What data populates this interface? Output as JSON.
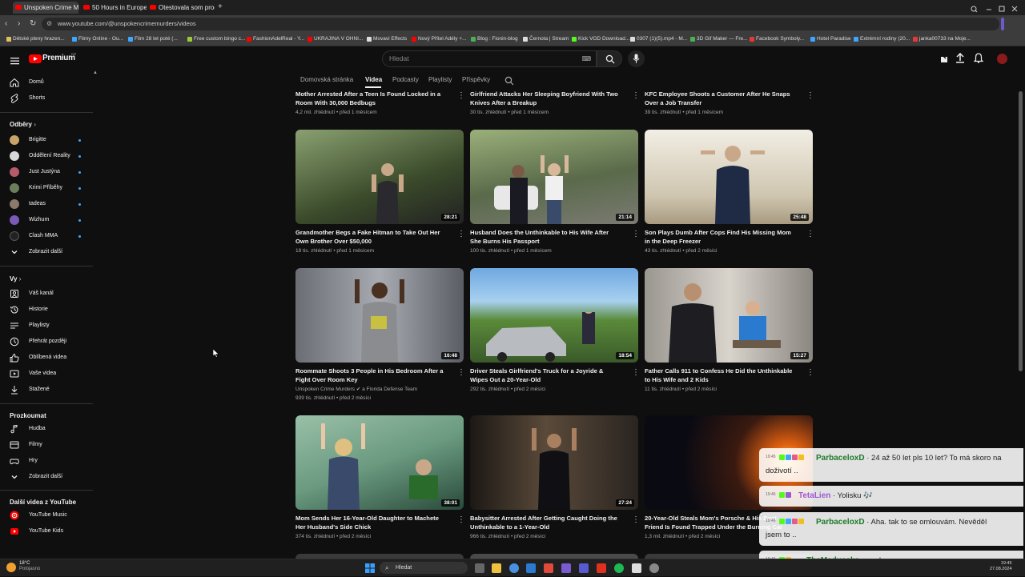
{
  "browser": {
    "tabs": [
      {
        "label": "Unspoken Crime Murders",
        "active": true
      },
      {
        "label": "50 Hours in Europe's Mo",
        "active": false
      },
      {
        "label": "Otestovala som produkty",
        "active": false
      }
    ],
    "url": "www.youtube.com/@unspokencrimemurders/videos",
    "bookmarks": [
      "Dětské pleny hrazen...",
      "Filmy Online - Ou...",
      "Film 28 let poté (...",
      "Free custom bingo c...",
      "FashionAdelReal - Y...",
      "UKRAJINA V OHNI...",
      "Movavi Effects",
      "Nový Přítel Adély +...",
      "Blog : Fionin-blog",
      "Černota | Stream",
      "Kick VOD Download...",
      "0307 (1)(5).mp4 - M...",
      "3D Gif Maker — Fre...",
      "Facebook Symboly...",
      "Hotel Paradise",
      "Extrémní rodiny (20...",
      "janka00733 na Moje..."
    ]
  },
  "header": {
    "logo": "Premium",
    "logo_sup": "CZ",
    "search_placeholder": "Hledat"
  },
  "sidebar": {
    "main": [
      {
        "label": "Domů",
        "icon": "home-icon"
      },
      {
        "label": "Shorts",
        "icon": "shorts-icon"
      }
    ],
    "subs_title": "Odběry",
    "subs": [
      {
        "label": "Brigitte",
        "color": "#c9a46a"
      },
      {
        "label": "Oddělení Reality",
        "color": "#d8d8d8"
      },
      {
        "label": "Just Justýna",
        "color": "#b65b6a"
      },
      {
        "label": "Krimi Příběhy",
        "color": "#6b7d5a"
      },
      {
        "label": "tadeas",
        "color": "#8a7a6a"
      },
      {
        "label": "Wizhum",
        "color": "#7a5ab8"
      },
      {
        "label": "Clash MMA",
        "color": "#222222"
      }
    ],
    "show_more": "Zobrazit další",
    "you_title": "Vy",
    "you": [
      {
        "label": "Váš kanál",
        "icon": "channel-icon"
      },
      {
        "label": "Historie",
        "icon": "history-icon"
      },
      {
        "label": "Playlisty",
        "icon": "playlist-icon"
      },
      {
        "label": "Přehrát později",
        "icon": "watch-later-icon"
      },
      {
        "label": "Oblíbená videa",
        "icon": "like-icon"
      },
      {
        "label": "Vaše videa",
        "icon": "your-videos-icon"
      },
      {
        "label": "Stažené",
        "icon": "download-icon"
      }
    ],
    "explore_title": "Prozkoumat",
    "explore": [
      {
        "label": "Hudba",
        "icon": "music-icon"
      },
      {
        "label": "Filmy",
        "icon": "movies-icon"
      },
      {
        "label": "Hry",
        "icon": "gaming-icon"
      }
    ],
    "explore_more": "Zobrazit další",
    "more_title": "Další videa z YouTube",
    "more": [
      {
        "label": "YouTube Music"
      },
      {
        "label": "YouTube Kids"
      }
    ]
  },
  "channel_tabs": [
    "Domovská stránka",
    "Videa",
    "Podcasty",
    "Playlisty",
    "Příspěvky"
  ],
  "videos": [
    {
      "title": "Mother Arrested After a Teen Is Found Locked in a Room With 30,000 Bedbugs",
      "meta": "4,2 mil. zhlédnutí • před 1 měsícem"
    },
    {
      "title": "Girlfriend Attacks Her Sleeping Boyfriend With Two Knives After a Breakup",
      "meta": "30 tis. zhlédnutí • před 1 měsícem"
    },
    {
      "title": "KFC Employee Shoots a Customer After He Snaps Over a Job Transfer",
      "meta": "39 tis. zhlédnutí • před 1 měsícem"
    },
    {
      "title": "Grandmother Begs a Fake Hitman to Take Out Her Own Brother Over $50,000",
      "meta": "18 tis. zhlédnutí • před 1 měsícem",
      "duration": "28:21",
      "c1": "#6f7a4a",
      "c2": "#2d3a22"
    },
    {
      "title": "Husband Does the Unthinkable to His Wife After She Burns His Passport",
      "meta": "100 tis. zhlédnutí • před 1 měsícem",
      "duration": "21:14",
      "c1": "#7a9a6a",
      "c2": "#3a4a32"
    },
    {
      "title": "Son Plays Dumb After Cops Find His Missing Mom in the Deep Freezer",
      "meta": "43 tis. zhlédnutí • před 2 měsíci",
      "duration": "25:48",
      "c1": "#e8e2d4",
      "c2": "#9a8a70"
    },
    {
      "title": "Roommate Shoots 3 People in His Bedroom After a Fight Over Room Key",
      "meta_channel": "Unspoken Crime Murders",
      "meta_collab": "a Florida Defense Team",
      "meta": "939 tis. zhlédnutí • před 2 měsíci",
      "duration": "16:48",
      "c1": "#8a8f96",
      "c2": "#3c4046"
    },
    {
      "title": "Driver Steals Girlfriend's Truck for a Joyride & Wipes Out a 20-Year-Old",
      "meta": "292 tis. zhlédnutí • před 2 měsíci",
      "duration": "18:54",
      "c1": "#5a8ac0",
      "c2": "#4a6a3a"
    },
    {
      "title": "Father Calls 911 to Confess He Did the Unthinkable to His Wife and 2 Kids",
      "meta": "11 tis. zhlédnutí • před 2 měsíci",
      "duration": "15:27",
      "c1": "#b8b2a8",
      "c2": "#5a544c"
    },
    {
      "title": "Mom Sends Her 16-Year-Old Daughter to Machete Her Husband's Side Chick",
      "meta": "374 tis. zhlédnutí • před 2 měsíci",
      "duration": "38:01",
      "c1": "#7fa080",
      "c2": "#3a5a4a"
    },
    {
      "title": "Babysitter Arrested After Getting Caught Doing the Unthinkable to a 1-Year-Old",
      "meta": "966 tis. zhlédnutí • před 2 měsíci",
      "duration": "27:24",
      "c1": "#3a3430",
      "c2": "#1a1614"
    },
    {
      "title": "20-Year-Old Steals Mom's Porsche & His Best Friend Is Found Trapped Under the Burning Car",
      "meta": "1,3 mil. zhlédnutí • před 2 měsíci",
      "c1": "#1a1a24",
      "c2": "#c85a1a"
    }
  ],
  "chat": [
    {
      "time": "19:45",
      "user": "ParbaceloxD",
      "color": "#1d7a2a",
      "line1": "· 24 až 50 let pls 10 let? To má skoro na",
      "line2": "doživotí .."
    },
    {
      "time": "19:46",
      "user": "TetaLien",
      "color": "#9b59d0",
      "line1": "· Yolisku",
      "line2": ""
    },
    {
      "time": "19:46",
      "user": "ParbaceloxD",
      "color": "#1d7a2a",
      "line1": "· Aha. tak to se omlouvám. Nevěděl",
      "line2": "jsem to .."
    },
    {
      "time": "19:46",
      "user": "TheMedusska",
      "color": "#1d7a2a",
      "line1": "· zrudy",
      "line2": ""
    }
  ],
  "taskbar": {
    "weather": "18°C",
    "weather_desc": "Polojasno",
    "search": "Hledat",
    "time": "19:45",
    "date": "27.08.2024"
  }
}
